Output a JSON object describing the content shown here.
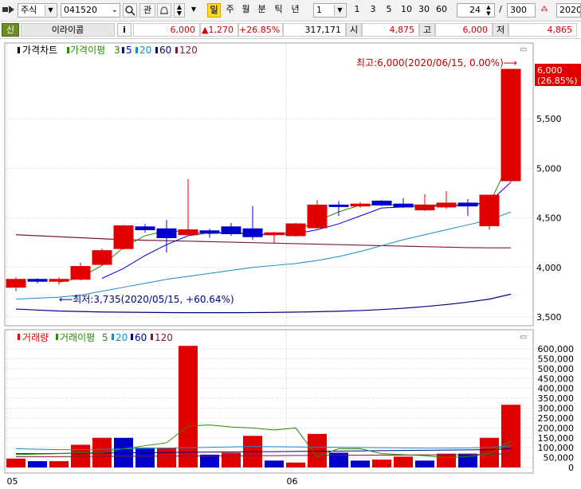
{
  "toolbar": {
    "market": "주식",
    "code": "041520",
    "btn_gwan": "관",
    "periods": [
      "일",
      "주",
      "월",
      "분",
      "틱",
      "년"
    ],
    "interval_select": "1",
    "intervals": [
      "1",
      "3",
      "5",
      "10",
      "30",
      "60"
    ],
    "view_count": "24",
    "slash": "/",
    "total_count": "300",
    "date_field": "2020/"
  },
  "info": {
    "shin": "신",
    "stock_name": "이라이콤",
    "info_btn": "i",
    "price": "6,000",
    "change": "▲1,270",
    "change_pct": "+26.85%",
    "volume": "317,171",
    "open_label": "시",
    "open": "4,875",
    "high_label": "고",
    "high": "6,000",
    "low_label": "저",
    "low": "4,865"
  },
  "colors": {
    "up": "#e00000",
    "down": "#0000cc",
    "ma3": "#2a8a00",
    "ma5": "#0000e0",
    "ma20": "#1a8ac8",
    "ma60": "#000080",
    "ma120": "#7a1a3a",
    "grid": "#cfcfcf",
    "annotation": "#c00000"
  },
  "chart_data": [
    {
      "type": "candlestick",
      "legend": [
        "가격차트",
        "가격이평",
        "3",
        "5",
        "20",
        "60",
        "120"
      ],
      "x_labels": [
        "05",
        "06"
      ],
      "y_ticks": [
        "5,500",
        "5,000",
        "4,500",
        "4,000",
        "3,500"
      ],
      "ylim": [
        3450,
        6050
      ],
      "annotation_high": "최고:6,000(2020/06/15, 0.00%)⟶",
      "annotation_low": "⟵최저:3,735(2020/05/15, +60.64%)",
      "last_price": "6,000",
      "last_pct": "(26.85%)",
      "candles": [
        {
          "o": 3800,
          "h": 3900,
          "l": 3760,
          "c": 3880
        },
        {
          "o": 3880,
          "h": 3890,
          "l": 3840,
          "c": 3860
        },
        {
          "o": 3860,
          "h": 3900,
          "l": 3830,
          "c": 3880
        },
        {
          "o": 3880,
          "h": 4050,
          "l": 3870,
          "c": 4010
        },
        {
          "o": 4030,
          "h": 4190,
          "l": 4020,
          "c": 4170
        },
        {
          "o": 4190,
          "h": 4430,
          "l": 4180,
          "c": 4420
        },
        {
          "o": 4410,
          "h": 4440,
          "l": 4350,
          "c": 4380
        },
        {
          "o": 4390,
          "h": 4480,
          "l": 4150,
          "c": 4300
        },
        {
          "o": 4330,
          "h": 4890,
          "l": 4320,
          "c": 4380
        },
        {
          "o": 4370,
          "h": 4390,
          "l": 4300,
          "c": 4350
        },
        {
          "o": 4410,
          "h": 4450,
          "l": 4320,
          "c": 4340
        },
        {
          "o": 4390,
          "h": 4620,
          "l": 4280,
          "c": 4310
        },
        {
          "o": 4330,
          "h": 4360,
          "l": 4240,
          "c": 4350
        },
        {
          "o": 4320,
          "h": 4450,
          "l": 4310,
          "c": 4440
        },
        {
          "o": 4400,
          "h": 4680,
          "l": 4390,
          "c": 4630
        },
        {
          "o": 4630,
          "h": 4670,
          "l": 4520,
          "c": 4620
        },
        {
          "o": 4620,
          "h": 4660,
          "l": 4600,
          "c": 4640
        },
        {
          "o": 4670,
          "h": 4680,
          "l": 4620,
          "c": 4630
        },
        {
          "o": 4640,
          "h": 4700,
          "l": 4600,
          "c": 4610
        },
        {
          "o": 4580,
          "h": 4740,
          "l": 4570,
          "c": 4630
        },
        {
          "o": 4610,
          "h": 4770,
          "l": 4590,
          "c": 4650
        },
        {
          "o": 4650,
          "h": 4690,
          "l": 4520,
          "c": 4620
        },
        {
          "o": 4420,
          "h": 4730,
          "l": 4380,
          "c": 4730
        },
        {
          "o": 4875,
          "h": 6000,
          "l": 4865,
          "c": 6000
        }
      ],
      "ma3": [
        null,
        null,
        3850,
        3900,
        4020,
        4200,
        4320,
        4370,
        4360,
        4340,
        4350,
        4330,
        4330,
        4370,
        4470,
        4560,
        4630,
        4630,
        4630,
        4630,
        4630,
        4630,
        4640,
        5100
      ],
      "ma5": [
        null,
        null,
        null,
        null,
        3890,
        3990,
        4120,
        4230,
        4320,
        4350,
        4350,
        4340,
        4330,
        4340,
        4380,
        4440,
        4520,
        4600,
        4610,
        4620,
        4620,
        4630,
        4660,
        4860
      ],
      "ma20": [
        3680,
        3690,
        3700,
        3720,
        3760,
        3800,
        3840,
        3880,
        3910,
        3940,
        3970,
        4000,
        4020,
        4040,
        4070,
        4110,
        4160,
        4220,
        4280,
        4330,
        4380,
        4430,
        4480,
        4560
      ],
      "ma60": [
        3580,
        3570,
        3560,
        3555,
        3550,
        3548,
        3546,
        3544,
        3543,
        3543,
        3543,
        3544,
        3546,
        3549,
        3553,
        3558,
        3565,
        3575,
        3588,
        3605,
        3625,
        3650,
        3680,
        3730
      ],
      "ma120": [
        4330,
        4320,
        4310,
        4300,
        4290,
        4280,
        4275,
        4270,
        4265,
        4260,
        4255,
        4250,
        4245,
        4240,
        4235,
        4230,
        4225,
        4220,
        4215,
        4210,
        4205,
        4200,
        4198,
        4198
      ]
    },
    {
      "type": "bar",
      "legend": [
        "거래량",
        "거래이평",
        "5",
        "20",
        "60",
        "120"
      ],
      "y_ticks": [
        "600,000",
        "550,000",
        "500,000",
        "450,000",
        "400,000",
        "350,000",
        "300,000",
        "250,000",
        "200,000",
        "150,000",
        "100,000",
        "50,000",
        "0"
      ],
      "ylim": [
        0,
        625000
      ],
      "volumes": [
        45000,
        32000,
        32000,
        115000,
        150000,
        150000,
        100000,
        100000,
        615000,
        65000,
        75000,
        160000,
        35000,
        25000,
        170000,
        75000,
        35000,
        40000,
        55000,
        35000,
        70000,
        70000,
        150000,
        317171
      ],
      "direction": [
        "up",
        "down",
        "up",
        "up",
        "up",
        "down",
        "down",
        "up",
        "up",
        "down",
        "up",
        "up",
        "down",
        "up",
        "up",
        "down",
        "down",
        "up",
        "up",
        "down",
        "up",
        "down",
        "up",
        "up"
      ],
      "vma5": [
        65000,
        68000,
        70000,
        75000,
        75000,
        95000,
        110000,
        125000,
        210000,
        215000,
        205000,
        200000,
        190000,
        200000,
        55000,
        95000,
        95000,
        70000,
        65000,
        60000,
        50000,
        55000,
        70000,
        135000
      ],
      "vma20": [
        95000,
        92000,
        90000,
        90000,
        92000,
        94000,
        96000,
        98000,
        100000,
        102000,
        104000,
        106000,
        105000,
        104000,
        103000,
        102000,
        101000,
        100000,
        99000,
        98000,
        98000,
        99000,
        101000,
        110000
      ],
      "vma60": [
        70000,
        70000,
        71000,
        72000,
        73000,
        74000,
        75000,
        76000,
        77000,
        78000,
        79000,
        80000,
        80000,
        81000,
        82000,
        83000,
        84000,
        85000,
        86000,
        87000,
        88000,
        89000,
        90000,
        95000
      ],
      "vma120": [
        55000,
        55000,
        55000,
        56000,
        56000,
        57000,
        57000,
        58000,
        58000,
        59000,
        59000,
        60000,
        60000,
        61000,
        61000,
        62000,
        62000,
        63000,
        63000,
        64000,
        64000,
        65000,
        66000,
        70000
      ]
    }
  ]
}
